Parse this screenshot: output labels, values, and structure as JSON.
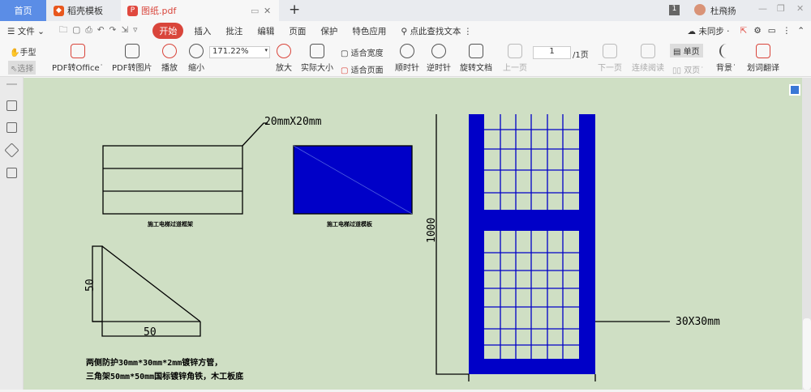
{
  "tabs": {
    "home": "首页",
    "templates": "稻壳模板",
    "active": "图纸.pdf",
    "new": "+"
  },
  "titlebar": {
    "badge": "1",
    "user": "杜飛扬",
    "minimize": "—",
    "restore": "❐",
    "close": "✕"
  },
  "menu": {
    "file": "文件",
    "items": [
      "开始",
      "插入",
      "批注",
      "编辑",
      "页面",
      "保护",
      "特色应用"
    ],
    "search_placeholder": "点此查找文本",
    "sync": "未同步"
  },
  "toolbar": {
    "hand": "手型",
    "select": "选择",
    "pdf_to_office": "PDF转Office",
    "pdf_to_image": "PDF转图片",
    "play": "播放",
    "zoom_out": "缩小",
    "zoom_value": "171.22%",
    "zoom_in": "放大",
    "actual_size": "实际大小",
    "fit_width": "适合宽度",
    "fit_page": "适合页面",
    "rotate_cw": "顺时针",
    "rotate_ccw": "逆时针",
    "rotate_doc": "旋转文档",
    "prev_page": "上一页",
    "page_value": "1",
    "page_total": "/1页",
    "next_page": "下一页",
    "continuous": "连续阅读",
    "single": "单页",
    "double": "双页",
    "background": "背景",
    "translate": "划词翻译"
  },
  "drawing": {
    "frame_dim": "20mmX20mm",
    "frame_label": "施工电梯过道框架",
    "board_label": "施工电梯过道模板",
    "tri_height": "50",
    "tri_width": "50",
    "note_line1": "两侧防护30mm*30mm*2mm镀锌方管，",
    "note_line2": "三角架50mm*50mm国标镀锌角铁，木工板底",
    "height_dim": "1000",
    "mesh_dim": "30X30mm"
  },
  "colors": {
    "accent": "#d9453b",
    "page_bg": "#cfdfc4",
    "panel_blue": "#0000c8"
  }
}
